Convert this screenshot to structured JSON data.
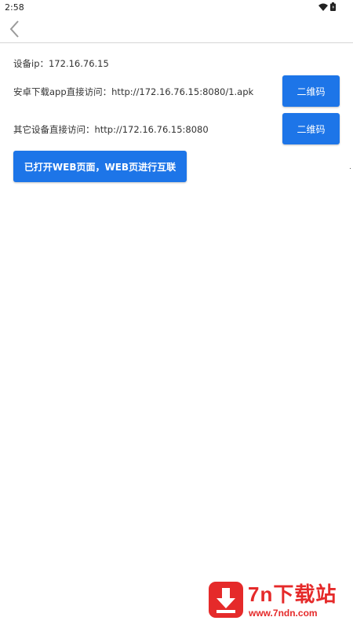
{
  "status_bar": {
    "time": "2:58",
    "icons": [
      "wifi-icon",
      "battery-icon"
    ]
  },
  "app_bar": {
    "back_icon": "chevron-left-icon"
  },
  "main": {
    "device_ip": "设备ip：172.16.76.15",
    "android_download": "安卓下载app直接访问：http://172.16.76.15:8080/1.apk",
    "other_device": "其它设备直接访问：http://172.16.76.15:8080",
    "qr_button_1": "二维码",
    "qr_button_2": "二维码",
    "web_button": "已打开WEB页面，WEB页进行互联"
  },
  "watermark": {
    "title": "7n下载站",
    "url": "www.7ndn.com"
  },
  "colors": {
    "accent": "#1d75e8",
    "watermark": "#e52a2a"
  }
}
